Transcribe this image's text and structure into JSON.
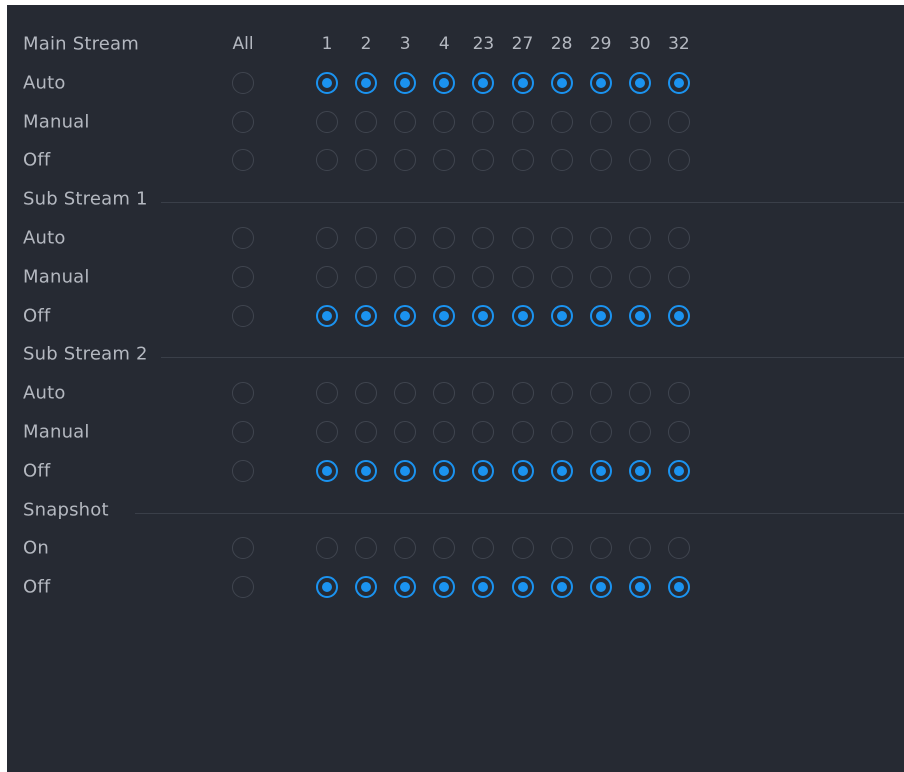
{
  "header": {
    "title": "Main Stream",
    "all_label": "All",
    "channels": [
      "1",
      "2",
      "3",
      "4",
      "23",
      "27",
      "28",
      "29",
      "30",
      "32"
    ]
  },
  "sections": [
    {
      "title": "Main Stream",
      "options": [
        {
          "label": "Auto",
          "all": false,
          "values": [
            true,
            true,
            true,
            true,
            true,
            true,
            true,
            true,
            true,
            true
          ]
        },
        {
          "label": "Manual",
          "all": false,
          "values": [
            false,
            false,
            false,
            false,
            false,
            false,
            false,
            false,
            false,
            false
          ]
        },
        {
          "label": "Off",
          "all": false,
          "values": [
            false,
            false,
            false,
            false,
            false,
            false,
            false,
            false,
            false,
            false
          ]
        }
      ]
    },
    {
      "title": "Sub Stream 1",
      "options": [
        {
          "label": "Auto",
          "all": false,
          "values": [
            false,
            false,
            false,
            false,
            false,
            false,
            false,
            false,
            false,
            false
          ]
        },
        {
          "label": "Manual",
          "all": false,
          "values": [
            false,
            false,
            false,
            false,
            false,
            false,
            false,
            false,
            false,
            false
          ]
        },
        {
          "label": "Off",
          "all": false,
          "values": [
            true,
            true,
            true,
            true,
            true,
            true,
            true,
            true,
            true,
            true
          ]
        }
      ]
    },
    {
      "title": "Sub Stream 2",
      "options": [
        {
          "label": "Auto",
          "all": false,
          "values": [
            false,
            false,
            false,
            false,
            false,
            false,
            false,
            false,
            false,
            false
          ]
        },
        {
          "label": "Manual",
          "all": false,
          "values": [
            false,
            false,
            false,
            false,
            false,
            false,
            false,
            false,
            false,
            false
          ]
        },
        {
          "label": "Off",
          "all": false,
          "values": [
            true,
            true,
            true,
            true,
            true,
            true,
            true,
            true,
            true,
            true
          ]
        }
      ]
    },
    {
      "title": "Snapshot",
      "options": [
        {
          "label": "On",
          "all": false,
          "values": [
            false,
            false,
            false,
            false,
            false,
            false,
            false,
            false,
            false,
            false
          ]
        },
        {
          "label": "Off",
          "all": false,
          "values": [
            true,
            true,
            true,
            true,
            true,
            true,
            true,
            true,
            true,
            true
          ]
        }
      ]
    }
  ],
  "colors": {
    "background": "#262a33",
    "text": "#b4b8c0",
    "accent": "#1b93f0",
    "radio_border": "#40454f",
    "divider": "#3a3f49"
  }
}
